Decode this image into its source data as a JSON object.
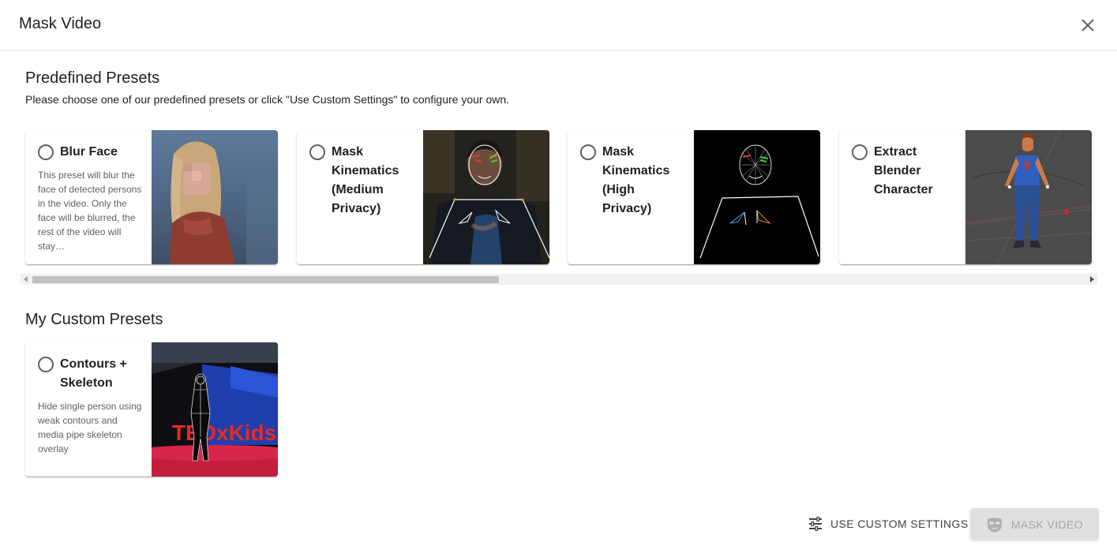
{
  "dialog": {
    "title": "Mask Video"
  },
  "predefined": {
    "title": "Predefined Presets",
    "subtitle": "Please choose one of our predefined presets or click \"Use Custom Settings\" to configure your own.",
    "cards": [
      {
        "title": "Blur Face",
        "description": "This preset will blur the face of detected persons in the video. Only the face will be blurred, the rest of the video will stay…"
      },
      {
        "title": "Mask Kinematics (Medium Privacy)",
        "description": ""
      },
      {
        "title": "Mask Kinematics (High Privacy)",
        "description": ""
      },
      {
        "title": "Extract Blender Character",
        "description": ""
      }
    ]
  },
  "custom": {
    "title": "My Custom Presets",
    "cards": [
      {
        "title": "Contours + Skeleton",
        "description": "Hide single person using weak contours and media pipe skeleton overlay",
        "image_text": "TEDxKids"
      }
    ]
  },
  "actions": {
    "custom_settings_label": "USE CUSTOM SETTINGS",
    "mask_video_label": "MASK VIDEO"
  },
  "icons": {
    "close": "close-icon",
    "settings": "tune-icon",
    "mask": "mask-icon"
  },
  "colors": {
    "disabled_bg": "#e0e0e0",
    "disabled_text": "#a6a6a6",
    "ted_red": "#e62b1e"
  }
}
